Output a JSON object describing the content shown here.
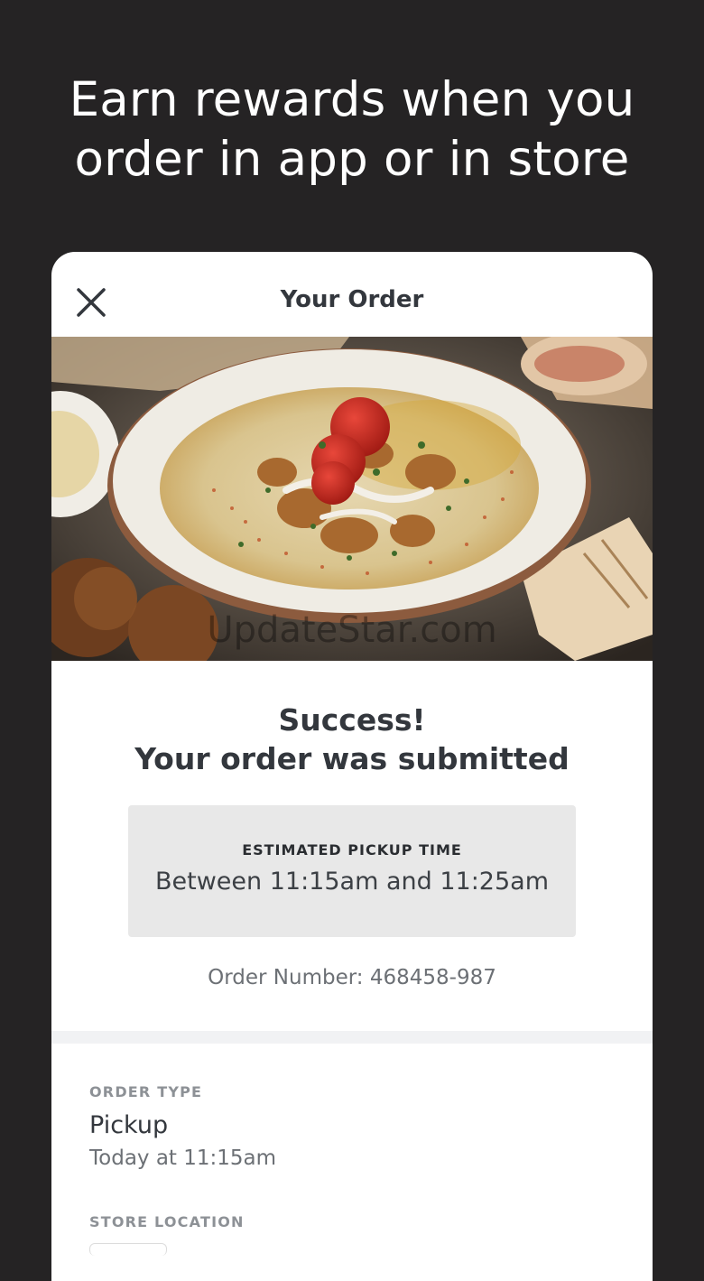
{
  "promo": {
    "line1": "Earn rewards when you",
    "line2": "order in app or in store"
  },
  "header": {
    "title": "Your Order",
    "close_icon": "close-icon"
  },
  "hero": {
    "watermark": "UpdateStar.com"
  },
  "confirmation": {
    "line1": "Success!",
    "line2": "Your order was submitted"
  },
  "pickup": {
    "label": "ESTIMATED PICKUP TIME",
    "time": "Between 11:15am and 11:25am"
  },
  "order_number": "Order Number: 468458-987",
  "details": {
    "order_type_label": "ORDER TYPE",
    "order_type_value": "Pickup",
    "order_type_time": "Today at 11:15am",
    "store_location_label": "STORE LOCATION"
  },
  "colors": {
    "background": "#252324",
    "card": "#ffffff",
    "text_dark": "#33373d",
    "text_muted": "#6c7075",
    "pickup_box": "#e8e8e8"
  }
}
